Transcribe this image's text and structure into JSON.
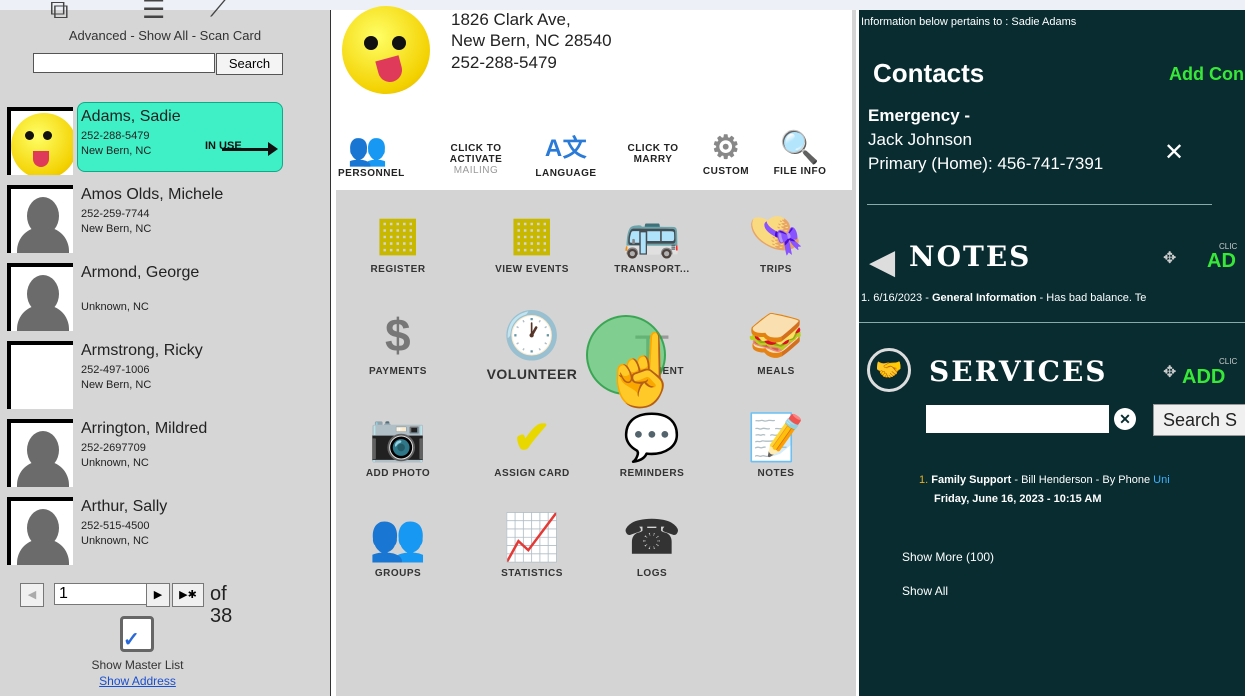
{
  "left": {
    "links": "Advanced - Show All - Scan Card",
    "search_button": "Search",
    "in_use_label": "IN USE",
    "people": [
      {
        "name": "Adams, Sadie",
        "phone": "252-288-5479",
        "city": "New Bern, NC"
      },
      {
        "name": "Amos Olds, Michele",
        "phone": "252-259-7744",
        "city": "New Bern, NC"
      },
      {
        "name": "Armond, George",
        "phone": "",
        "city": "Unknown, NC"
      },
      {
        "name": "Armstrong, Ricky",
        "phone": "252-497-1006",
        "city": "New Bern, NC"
      },
      {
        "name": "Arrington, Mildred",
        "phone": "252-2697709",
        "city": "Unknown, NC"
      },
      {
        "name": "Arthur, Sally",
        "phone": "252-515-4500",
        "city": "Unknown, NC"
      }
    ],
    "pager": {
      "page": "1",
      "of_text": "of 38"
    },
    "master_list": "Show Master List",
    "show_address": "Show Address"
  },
  "middle": {
    "address_line1": "1826 Clark Ave,",
    "address_line2": "New Bern, NC 28540",
    "address_phone": "252-288-5479",
    "tools": [
      {
        "label": "PERSONNEL",
        "icon": "people-icon"
      },
      {
        "label": "CLICK TO ACTIVATE",
        "sub": "MAILING",
        "icon": "mail-icon"
      },
      {
        "label": "LANGUAGE",
        "icon": "translate-icon"
      },
      {
        "label": "CLICK TO MARRY",
        "icon": "marry-icon"
      },
      {
        "label": "CUSTOM",
        "icon": "gear-icon"
      },
      {
        "label": "FILE INFO",
        "icon": "file-search-icon"
      }
    ],
    "grid": [
      {
        "label": "REGISTER",
        "icon": "register-icon"
      },
      {
        "label": "VIEW EVENTS",
        "icon": "calendar-search-icon"
      },
      {
        "label": "TRANSPORT...",
        "icon": "bus-icon"
      },
      {
        "label": "TRIPS",
        "icon": "hat-icon"
      },
      {
        "label": "PAYMENTS",
        "icon": "dollar-icon"
      },
      {
        "label": "VOLUNTEER",
        "icon": "clock-icon"
      },
      {
        "label": "EQUIPMENT",
        "icon": "walker-icon"
      },
      {
        "label": "MEALS",
        "icon": "sandwich-icon"
      },
      {
        "label": "ADD PHOTO",
        "icon": "webcam-icon"
      },
      {
        "label": "ASSIGN CARD",
        "icon": "id-card-icon"
      },
      {
        "label": "REMINDERS",
        "icon": "bubble-icon"
      },
      {
        "label": "NOTES",
        "icon": "notepad-icon"
      },
      {
        "label": "GROUPS",
        "icon": "group-icon"
      },
      {
        "label": "STATISTICS",
        "icon": "chart-icon"
      },
      {
        "label": "LOGS",
        "icon": "phone-icon"
      }
    ]
  },
  "right": {
    "info": "Information below pertains to : Sadie Adams",
    "contacts_title": "Contacts",
    "add_contact": "Add Con",
    "emergency": "Emergency -",
    "contact_name": "Jack Johnson",
    "contact_phone": "Primary (Home): 456-741-7391",
    "notes_title": "NOTES",
    "notes_add_cli": "CLIC",
    "notes_add": "AD",
    "note_prefix": "1. 6/16/2023 - ",
    "note_category": "General Information",
    "note_text": " - Has bad balance. Te",
    "services_title": "SERVICES",
    "services_add_cli": "CLIC",
    "services_add": "ADD",
    "search_services": "Search S",
    "service_num": "1. ",
    "service_name": "Family Support",
    "service_detail": " - Bill Henderson - By Phone ",
    "service_link": "Uni",
    "service_date": "Friday, June 16, 2023 - 10:15 AM",
    "show_more": "Show More (100)",
    "show_all": "Show All"
  }
}
